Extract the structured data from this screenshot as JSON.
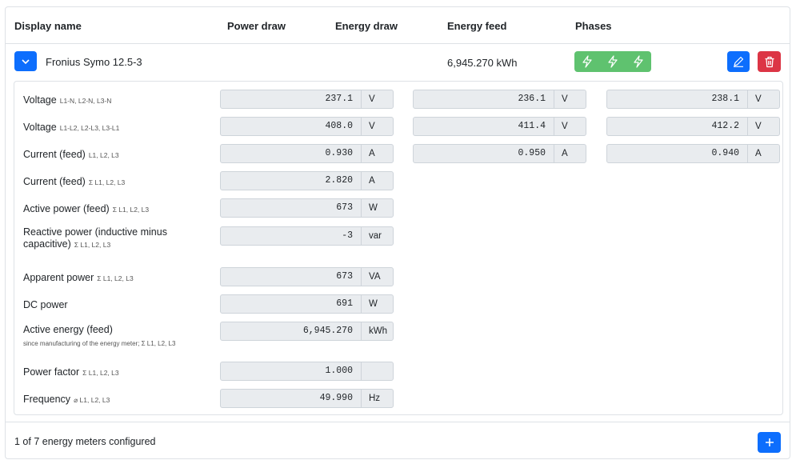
{
  "table": {
    "headers": {
      "display_name": "Display name",
      "power_draw": "Power draw",
      "energy_draw": "Energy draw",
      "energy_feed": "Energy feed",
      "phases": "Phases"
    }
  },
  "meter": {
    "name": "Fronius Symo 12.5-3",
    "energy_feed": "6,945.270 kWh",
    "phase_icons": [
      "lightning-icon",
      "lightning-icon",
      "lightning-icon"
    ],
    "expand_icon": "chevron-down-icon",
    "edit_icon": "pencil-icon",
    "delete_icon": "trash-icon"
  },
  "details": [
    {
      "label": "Voltage",
      "sub": "L1-N, L2-N, L3-N",
      "values": [
        {
          "v": "237.1",
          "u": "V"
        },
        {
          "v": "236.1",
          "u": "V"
        },
        {
          "v": "238.1",
          "u": "V"
        }
      ]
    },
    {
      "label": "Voltage",
      "sub": "L1-L2, L2-L3, L3-L1",
      "values": [
        {
          "v": "408.0",
          "u": "V"
        },
        {
          "v": "411.4",
          "u": "V"
        },
        {
          "v": "412.2",
          "u": "V"
        }
      ]
    },
    {
      "label": "Current (feed)",
      "sub": "L1, L2, L3",
      "values": [
        {
          "v": "0.930",
          "u": "A"
        },
        {
          "v": "0.950",
          "u": "A"
        },
        {
          "v": "0.940",
          "u": "A"
        }
      ]
    },
    {
      "label": "Current (feed)",
      "sub": "Σ L1, L2, L3",
      "values": [
        {
          "v": "2.820",
          "u": "A"
        }
      ]
    },
    {
      "label": "Active power (feed)",
      "sub": "Σ L1, L2, L3",
      "values": [
        {
          "v": "673",
          "u": "W"
        }
      ]
    },
    {
      "label": "Reactive power (inductive minus capacitive)",
      "sub": "Σ L1, L2, L3",
      "values": [
        {
          "v": "-3",
          "u": "var"
        }
      ]
    },
    {
      "label": "Apparent power",
      "sub": "Σ L1, L2, L3",
      "values": [
        {
          "v": "673",
          "u": "VA"
        }
      ]
    },
    {
      "label": "DC power",
      "sub": "",
      "values": [
        {
          "v": "691",
          "u": "W"
        }
      ]
    },
    {
      "label": "Active energy (feed)",
      "sub": "",
      "note": "since manufacturing of the energy meter; Σ L1, L2, L3",
      "values": [
        {
          "v": "6,945.270",
          "u": "kWh"
        }
      ]
    },
    {
      "label": "Power factor",
      "sub": "Σ L1, L2, L3",
      "values": [
        {
          "v": "1.000",
          "u": ""
        }
      ]
    },
    {
      "label": "Frequency",
      "sub": "⌀ L1, L2, L3",
      "values": [
        {
          "v": "49.990",
          "u": "Hz"
        }
      ]
    }
  ],
  "footer": {
    "count_text": "1 of 7 energy meters configured",
    "add_icon": "plus-icon"
  },
  "colors": {
    "primary": "#0d6efd",
    "success": "#5fc26f",
    "danger": "#dc3545"
  }
}
